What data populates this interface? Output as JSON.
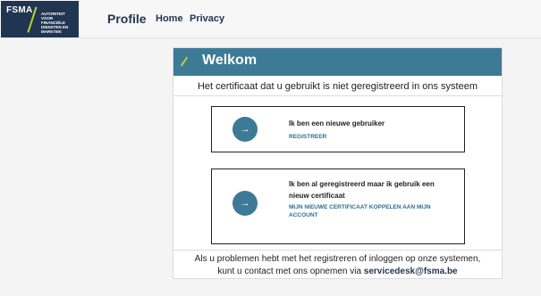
{
  "brand": {
    "abbr": "FSMA",
    "subtitle": "AUTORITEIT VOOR FINANCIËLE DIENSTEN EN MARKTEN"
  },
  "header": {
    "title": "Profile",
    "nav": [
      "Home",
      "Privacy"
    ]
  },
  "panel": {
    "title": "Welkom",
    "notice": "Het certificaat dat u gebruikt is niet geregistreerd in ons systeem",
    "options": [
      {
        "title": "Ik ben een nieuwe gebruiker",
        "link": "REGISTREER"
      },
      {
        "title": "Ik ben al geregistreerd maar ik gebruik een nieuw certificaat",
        "link": "MIJN NIEUWE CERTIFICAAT KOPPELEN AAN MIJN ACCOUNT"
      }
    ],
    "footer_line1": "Als u problemen hebt met het registreren of inloggen op onze systemen,",
    "footer_line2_prefix": "kunt u contact met ons opnemen via ",
    "footer_email": "servicedesk@fsma.be"
  },
  "colors": {
    "navy": "#1f3552",
    "teal": "#3d7a96",
    "lime": "#b9d232"
  },
  "icons": [
    "arrow-right-icon"
  ]
}
